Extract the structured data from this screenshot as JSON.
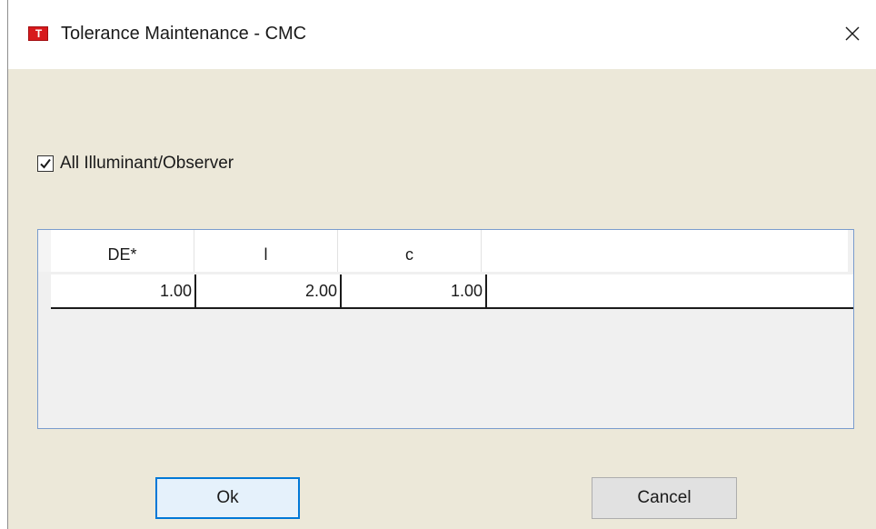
{
  "window": {
    "title": "Tolerance Maintenance - CMC",
    "app_icon": "app-logo-icon",
    "app_icon_glyph": "T",
    "close_icon": "close-icon"
  },
  "options": {
    "all_illuminant_label": "All Illuminant/Observer",
    "all_illuminant_checked": true
  },
  "grid": {
    "columns": [
      "DE*",
      "l",
      "c"
    ],
    "rows": [
      [
        "1.00",
        "2.00",
        "1.00"
      ]
    ]
  },
  "buttons": {
    "ok_label": "Ok",
    "cancel_label": "Cancel"
  },
  "colors": {
    "dialog_background": "#ece8d9",
    "focus_border": "#0078d7",
    "icon_red": "#d7191c"
  }
}
